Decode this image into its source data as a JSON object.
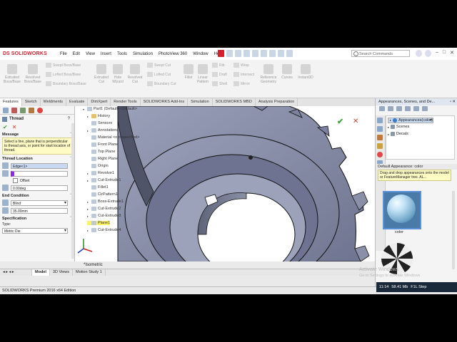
{
  "app": {
    "brand": "SOLIDWORKS",
    "brand_mark": "DS"
  },
  "menubar": {
    "items": [
      "File",
      "Edit",
      "View",
      "Insert",
      "Tools",
      "Simulation",
      "PhotoView 360",
      "Window",
      "Help"
    ],
    "search_placeholder": "Search Commands"
  },
  "command_manager": {
    "left_group": {
      "extruded": "Extruded Boss/Base",
      "revolved": "Revolved Boss/Base",
      "swept": "Swept Boss/Base",
      "lofted": "Lofted Boss/Base",
      "boundary": "Boundary Boss/Base"
    },
    "cut_group": {
      "extruded_cut": "Extruded Cut",
      "hole_wizard": "Hole Wizard",
      "revolved_cut": "Revolved Cut",
      "swept_cut": "Swept Cut",
      "lofted_cut": "Lofted Cut",
      "boundary_cut": "Boundary Cut"
    },
    "features": {
      "fillet": "Fillet",
      "linear_pattern": "Linear Pattern",
      "rib": "Rib",
      "draft": "Draft",
      "shell": "Shell",
      "wrap": "Wrap",
      "intersect": "Intersect",
      "mirror": "Mirror",
      "reference_geometry": "Reference Geometry",
      "curves": "Curves",
      "instant3d": "Instant3D"
    }
  },
  "tabs": [
    "Features",
    "Sketch",
    "Weldments",
    "Evaluate",
    "DimXpert",
    "Render Tools",
    "SOLIDWORKS Add-Ins",
    "Simulation",
    "SOLIDWORKS MBD",
    "Analysis Preparation"
  ],
  "property_manager": {
    "title": "Thread",
    "message_header": "Message",
    "message": "Select a line, plane that is perpendicular to thread axis, or point for start location of thread.",
    "thread_location": "Thread Location",
    "edge_value": "Edge<1>",
    "offset_label": "Offset",
    "angle_value": "0.00deg",
    "end_condition": "End Condition",
    "end_type": "Blind",
    "depth_value": "35.00mm",
    "specification": "Specification",
    "type_label": "Type:",
    "type_value": "Metric Die"
  },
  "tree": {
    "root": "Part1 (Default<<Default>",
    "items": [
      "History",
      "Sensors",
      "Annotations",
      "Material <not specified>",
      "Front Plane",
      "Top Plane",
      "Right Plane",
      "Origin",
      "Revolve1",
      "Cut-Extrude1",
      "Fillet1",
      "CirPattern1",
      "Boss-Extrude1",
      "Cut-Extrude2",
      "Cut-Extrude3",
      "Plane1",
      "Cut-Extrude4"
    ]
  },
  "graphics": {
    "view_label": "*Isometric"
  },
  "task_pane": {
    "title": "Appearances, Scenes, and De...",
    "tree_items": [
      "Appearances(color)",
      "Scenes",
      "Decals"
    ],
    "default_label": "Default Appearance: color",
    "tip": "Drag and drop appearances onto the model or FeatureManager tree.  AL...",
    "swatch_label": "color"
  },
  "bottom_tabs": [
    "Model",
    "3D Views",
    "Motion Study 1"
  ],
  "status": {
    "text": "SOLIDWORKS Premium 2016 x64 Edition"
  },
  "watermark": {
    "line1": "Activate Windows",
    "line2": "Go to Settings to activate Windows."
  },
  "taskbar": {
    "time": "11:14",
    "rate": "58.41 Mb",
    "label": "F1L Step"
  },
  "colors": {
    "brand_red": "#d2202f",
    "selection_blue": "#c9dcf4",
    "accept_green": "#3ea03e",
    "edge_purple": "#8a2be2"
  }
}
